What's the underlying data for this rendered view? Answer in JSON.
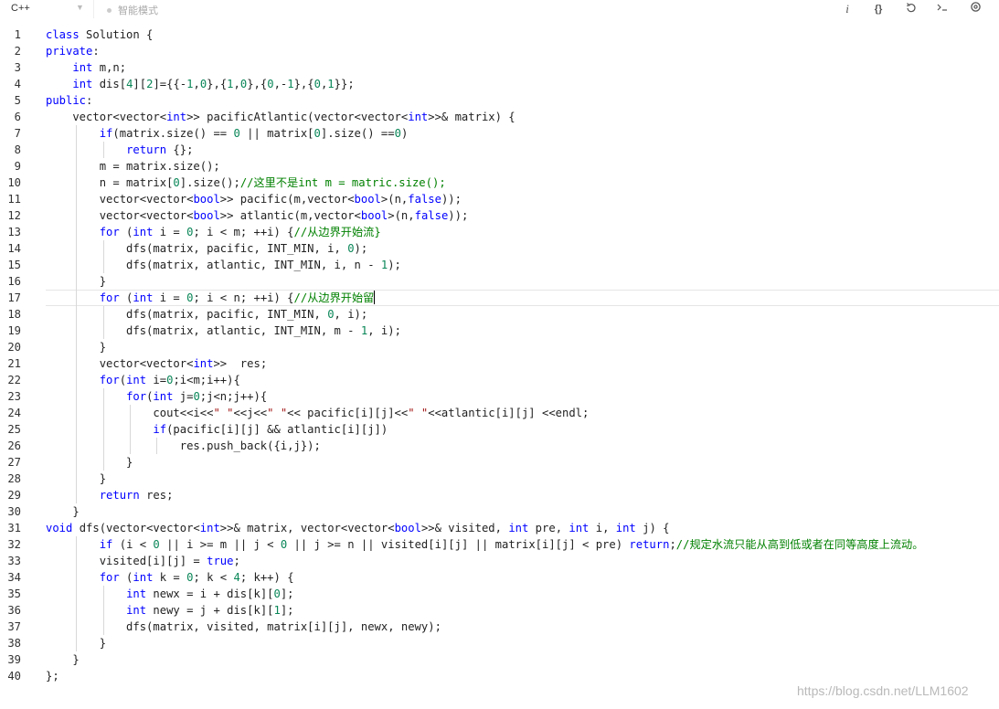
{
  "toolbar": {
    "language": "C++",
    "mode_label": "智能模式",
    "icons": [
      "info-icon",
      "braces-icon",
      "undo-icon",
      "terminal-icon",
      "settings-icon"
    ]
  },
  "editor": {
    "active_line": 17,
    "lines": [
      "class Solution {",
      "private:",
      "    int m,n;",
      "    int dis[4][2]={{-1,0},{1,0},{0,-1},{0,1}};",
      "public:",
      "    vector<vector<int>> pacificAtlantic(vector<vector<int>>& matrix) {",
      "        if(matrix.size() == 0 || matrix[0].size() ==0)",
      "            return {};",
      "        m = matrix.size();",
      "        n = matrix[0].size();//这里不是int m = matric.size();",
      "        vector<vector<bool>> pacific(m,vector<bool>(n,false));",
      "        vector<vector<bool>> atlantic(m,vector<bool>(n,false));",
      "        for (int i = 0; i < m; ++i) {//从边界开始流}",
      "            dfs(matrix, pacific, INT_MIN, i, 0);",
      "            dfs(matrix, atlantic, INT_MIN, i, n - 1);",
      "        }",
      "        for (int i = 0; i < n; ++i) {//从边界开始留",
      "            dfs(matrix, pacific, INT_MIN, 0, i);",
      "            dfs(matrix, atlantic, INT_MIN, m - 1, i);",
      "        }",
      "        vector<vector<int>>  res;",
      "        for(int i=0;i<m;i++){",
      "            for(int j=0;j<n;j++){",
      "                cout<<i<<\" \"<<j<<\" \"<< pacific[i][j]<<\" \"<<atlantic[i][j] <<endl;",
      "                if(pacific[i][j] && atlantic[i][j])",
      "                    res.push_back({i,j});",
      "            }",
      "        }",
      "        return res;",
      "    }",
      "void dfs(vector<vector<int>>& matrix, vector<vector<bool>>& visited, int pre, int i, int j) {",
      "        if (i < 0 || i >= m || j < 0 || j >= n || visited[i][j] || matrix[i][j] < pre) return;//规定水流只能从高到低或者在同等高度上流动。",
      "        visited[i][j] = true;",
      "        for (int k = 0; k < 4; k++) {",
      "            int newx = i + dis[k][0];",
      "            int newy = j + dis[k][1];",
      "            dfs(matrix, visited, matrix[i][j], newx, newy);",
      "        }",
      "    }",
      "};"
    ]
  },
  "watermark": "https://blog.csdn.net/LLM1602"
}
